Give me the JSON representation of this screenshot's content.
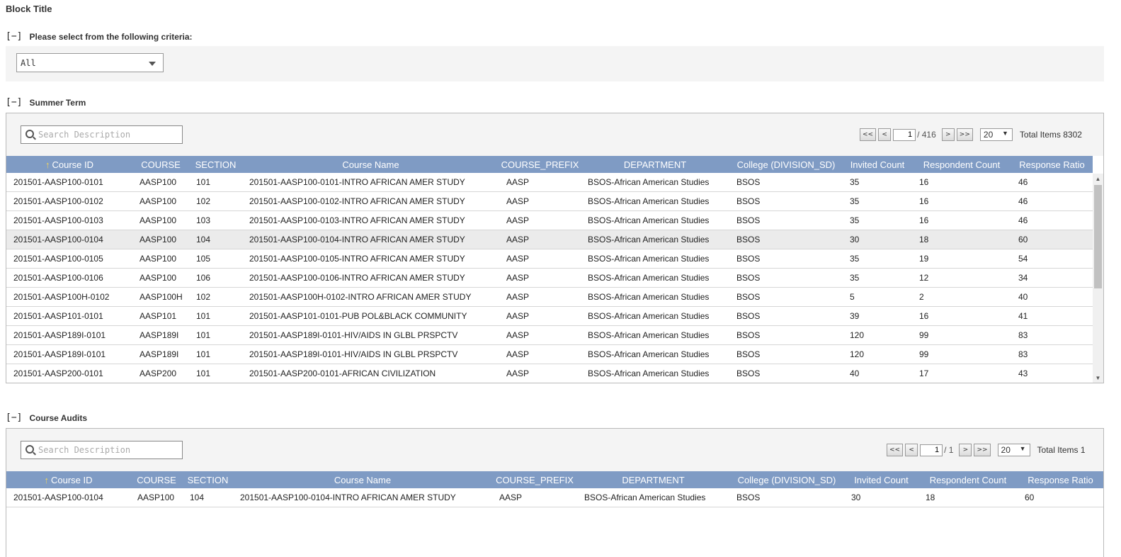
{
  "block_title": "Block Title",
  "criteria": {
    "toggle": "[−]",
    "label": "Please select from the following criteria:",
    "select_value": "All"
  },
  "summer": {
    "toggle": "[−]",
    "title": "Summer Term",
    "search_placeholder": "Search Description",
    "pager": {
      "first": "<<",
      "prev": "<",
      "page": "1",
      "total_pages": "/ 416",
      "next": ">",
      "last": ">>",
      "page_size": "20",
      "total_items": "Total Items 8302"
    },
    "columns": [
      "Course ID",
      "COURSE",
      "SECTION",
      "Course Name",
      "COURSE_PREFIX",
      "DEPARTMENT",
      "College (DIVISION_SD)",
      "Invited Count",
      "Respondent Count",
      "Response Ratio"
    ],
    "sort_arrow": "↑",
    "rows": [
      [
        "201501-AASP100-0101",
        "AASP100",
        "101",
        "201501-AASP100-0101-INTRO AFRICAN AMER STUDY",
        "AASP",
        "BSOS-African American Studies",
        "BSOS",
        "35",
        "16",
        "46"
      ],
      [
        "201501-AASP100-0102",
        "AASP100",
        "102",
        "201501-AASP100-0102-INTRO AFRICAN AMER STUDY",
        "AASP",
        "BSOS-African American Studies",
        "BSOS",
        "35",
        "16",
        "46"
      ],
      [
        "201501-AASP100-0103",
        "AASP100",
        "103",
        "201501-AASP100-0103-INTRO AFRICAN AMER STUDY",
        "AASP",
        "BSOS-African American Studies",
        "BSOS",
        "35",
        "16",
        "46"
      ],
      [
        "201501-AASP100-0104",
        "AASP100",
        "104",
        "201501-AASP100-0104-INTRO AFRICAN AMER STUDY",
        "AASP",
        "BSOS-African American Studies",
        "BSOS",
        "30",
        "18",
        "60"
      ],
      [
        "201501-AASP100-0105",
        "AASP100",
        "105",
        "201501-AASP100-0105-INTRO AFRICAN AMER STUDY",
        "AASP",
        "BSOS-African American Studies",
        "BSOS",
        "35",
        "19",
        "54"
      ],
      [
        "201501-AASP100-0106",
        "AASP100",
        "106",
        "201501-AASP100-0106-INTRO AFRICAN AMER STUDY",
        "AASP",
        "BSOS-African American Studies",
        "BSOS",
        "35",
        "12",
        "34"
      ],
      [
        "201501-AASP100H-0102",
        "AASP100H",
        "102",
        "201501-AASP100H-0102-INTRO AFRICAN AMER STUDY",
        "AASP",
        "BSOS-African American Studies",
        "BSOS",
        "5",
        "2",
        "40"
      ],
      [
        "201501-AASP101-0101",
        "AASP101",
        "101",
        "201501-AASP101-0101-PUB POL&BLACK COMMUNITY",
        "AASP",
        "BSOS-African American Studies",
        "BSOS",
        "39",
        "16",
        "41"
      ],
      [
        "201501-AASP189I-0101",
        "AASP189I",
        "101",
        "201501-AASP189I-0101-HIV/AIDS IN GLBL PRSPCTV",
        "AASP",
        "BSOS-African American Studies",
        "BSOS",
        "120",
        "99",
        "83"
      ],
      [
        "201501-AASP189I-0101",
        "AASP189I",
        "101",
        "201501-AASP189I-0101-HIV/AIDS IN GLBL PRSPCTV",
        "AASP",
        "BSOS-African American Studies",
        "BSOS",
        "120",
        "99",
        "83"
      ],
      [
        "201501-AASP200-0101",
        "AASP200",
        "101",
        "201501-AASP200-0101-AFRICAN CIVILIZATION",
        "AASP",
        "BSOS-African American Studies",
        "BSOS",
        "40",
        "17",
        "43"
      ]
    ],
    "selected_row": 3
  },
  "audits": {
    "toggle": "[−]",
    "title": "Course Audits",
    "search_placeholder": "Search Description",
    "pager": {
      "first": "<<",
      "prev": "<",
      "page": "1",
      "total_pages": "/ 1",
      "next": ">",
      "last": ">>",
      "page_size": "20",
      "total_items": "Total Items 1"
    },
    "columns": [
      "Course ID",
      "COURSE",
      "SECTION",
      "Course Name",
      "COURSE_PREFIX",
      "DEPARTMENT",
      "College (DIVISION_SD)",
      "Invited Count",
      "Respondent Count",
      "Response Ratio"
    ],
    "sort_arrow": "↑",
    "rows": [
      [
        "201501-AASP100-0104",
        "AASP100",
        "104",
        "201501-AASP100-0104-INTRO AFRICAN AMER STUDY",
        "AASP",
        "BSOS-African American Studies",
        "BSOS",
        "30",
        "18",
        "60"
      ]
    ]
  },
  "colors": {
    "header_bg": "#7f9bc4",
    "sort_arrow": "#f5d75a",
    "selected_row": "#ebebeb",
    "toolbar_bg": "#f4f4f4"
  },
  "icons": [
    "search-icon",
    "caret-down-icon",
    "sort-ascending-icon",
    "scroll-up-icon",
    "scroll-down-icon"
  ]
}
